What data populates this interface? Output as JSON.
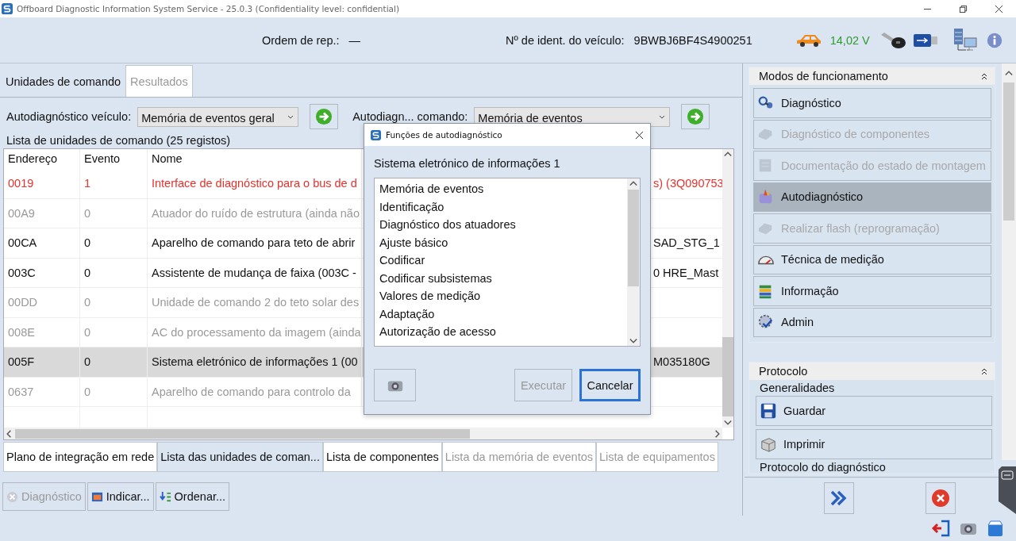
{
  "window": {
    "title": "Offboard Diagnostic Information System Service - 25.0.3 (Confidentiality level: confidential)"
  },
  "header": {
    "order_label": "Ordem de rep.:",
    "order_value": "—",
    "vin_label": "Nº de ident. do veículo:",
    "vin_value": "9BWBJ6BF4S4900251",
    "voltage": "14,02 V"
  },
  "top_tabs": [
    {
      "label": "Unidades de comando",
      "selected": true
    },
    {
      "label": "Resultados",
      "selected": false
    }
  ],
  "selectors": [
    {
      "label": "Autodiagnóstico veículo:",
      "value": "Memória de eventos geral"
    },
    {
      "label": "Autodiagn... comando:",
      "value": "Memória de eventos"
    }
  ],
  "list_title": "Lista de unidades de comando (25 registos)",
  "table": {
    "columns": [
      "Endereço",
      "Evento",
      "Nome"
    ],
    "rows": [
      {
        "address": "0019",
        "event": "1",
        "name": "Interface de diagnóstico para o bus de d",
        "column_4": "s) (3Q090753",
        "kind": "fault",
        "selected": false
      },
      {
        "address": "00A9",
        "event": "0",
        "name": "Atuador do ruído de estrutura (ainda não",
        "kind": "inactive",
        "selected": false
      },
      {
        "address": "00CA",
        "event": "0",
        "name": "Aparelho de comando para teto de abrir",
        "column_4": "SAD_STG_1",
        "kind": "normal",
        "selected": false
      },
      {
        "address": "003C",
        "event": "0",
        "name": "Assistente de mudança de faixa (003C -",
        "column_4": "0  HRE_Mast",
        "kind": "normal",
        "selected": false
      },
      {
        "address": "00DD",
        "event": "0",
        "name": "Unidade de comando 2 do teto solar des",
        "kind": "inactive",
        "selected": false
      },
      {
        "address": "008E",
        "event": "0",
        "name": "AC do processamento da imagem (ainda",
        "kind": "inactive",
        "selected": false
      },
      {
        "address": "005F",
        "event": "0",
        "name": "Sistema eletrónico de informações 1 (00",
        "column_4": "M035180G",
        "kind": "normal",
        "selected": true
      },
      {
        "address": "0637",
        "event": "0",
        "name": "Aparelho de comando para controlo da",
        "kind": "inactive",
        "selected": false
      }
    ]
  },
  "bottom_tabs": [
    {
      "label": "Plano de integração em rede",
      "selected": false,
      "disabled": false
    },
    {
      "label": "Lista das unidades de coman...",
      "selected": true,
      "disabled": false
    },
    {
      "label": "Lista de componentes",
      "selected": false,
      "disabled": false
    },
    {
      "label": "Lista da memória de eventos",
      "selected": false,
      "disabled": true
    },
    {
      "label": "Lista de equipamentos",
      "selected": false,
      "disabled": true
    }
  ],
  "actions": [
    {
      "label": "Diagnóstico",
      "disabled": true
    },
    {
      "label": "Indicar...",
      "disabled": false
    },
    {
      "label": "Ordenar...",
      "disabled": false
    }
  ],
  "modes": {
    "title": "Modos de funcionamento",
    "items": [
      {
        "label": "Diagnóstico",
        "disabled": false,
        "selected": false
      },
      {
        "label": "Diagnóstico de componentes",
        "disabled": true,
        "selected": false
      },
      {
        "label": "Documentação do estado de montagem",
        "disabled": true,
        "selected": false
      },
      {
        "label": "Autodiagnóstico",
        "disabled": false,
        "selected": true
      },
      {
        "label": "Realizar flash (reprogramação)",
        "disabled": true,
        "selected": false
      },
      {
        "label": "Técnica de medição",
        "disabled": false,
        "selected": false
      },
      {
        "label": "Informação",
        "disabled": false,
        "selected": false
      },
      {
        "label": "Admin",
        "disabled": false,
        "selected": false
      }
    ]
  },
  "protocol": {
    "title": "Protocolo",
    "group": "Generalidades",
    "buttons": [
      "Guardar",
      "Imprimir"
    ],
    "next_group": "Protocolo do diagnóstico"
  },
  "dialog": {
    "title": "Funções de autodiagnóstico",
    "subtitle": "Sistema eletrónico de informações 1",
    "items": [
      "Memória de eventos",
      "Identificação",
      "Diagnóstico dos atuadores",
      "Ajuste básico",
      "Codificar",
      "Codificar subsistemas",
      "Valores de medição",
      "Adaptação",
      "Autorização de acesso"
    ],
    "buttons": [
      {
        "label": "Executar",
        "disabled": true,
        "default": false
      },
      {
        "label": "Cancelar",
        "disabled": false,
        "default": true
      }
    ]
  }
}
